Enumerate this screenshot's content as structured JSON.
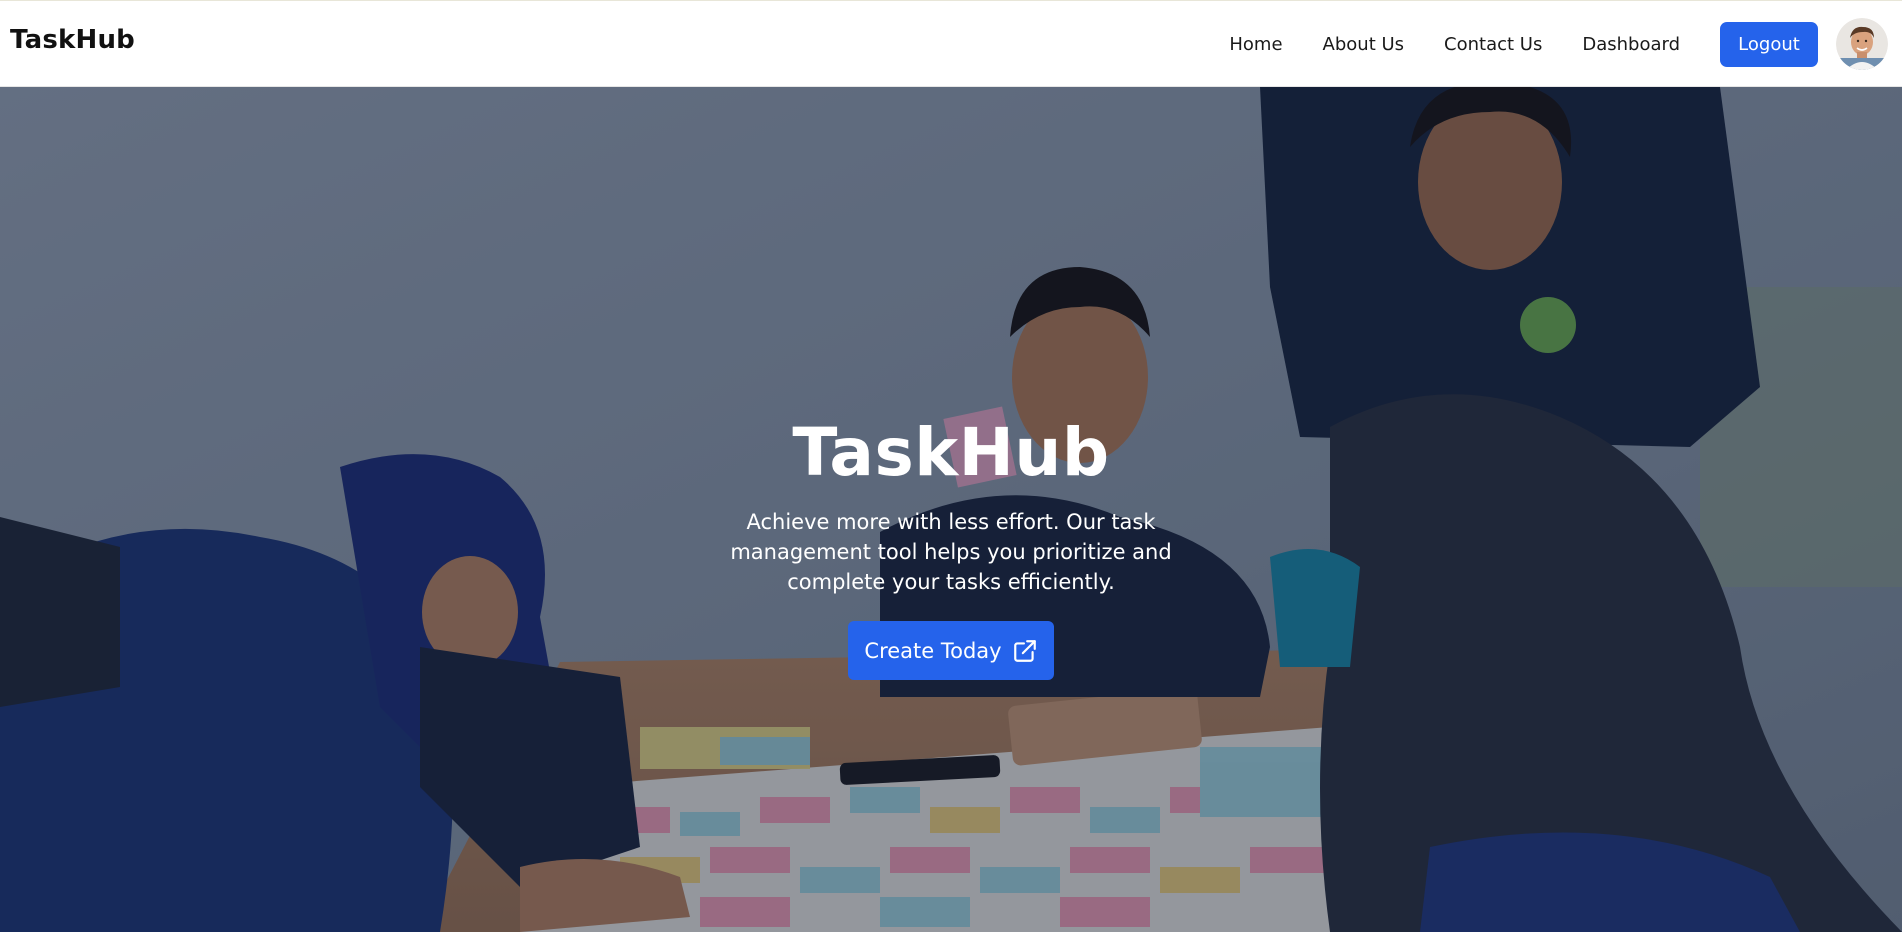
{
  "navbar": {
    "brand": "TaskHub",
    "links": [
      "Home",
      "About Us",
      "Contact Us",
      "Dashboard"
    ],
    "logout_label": "Logout",
    "avatar_icon": "user-avatar-icon"
  },
  "hero": {
    "title": "TaskHub",
    "description": "Achieve more with less effort. Our task management tool helps you prioritize and complete your tasks efficiently.",
    "cta_label": "Create Today",
    "cta_icon": "external-link-icon"
  },
  "colors": {
    "accent": "#2563eb",
    "nav_text": "#1a1a1a",
    "brand_text": "#111111",
    "hero_text": "#ffffff"
  }
}
